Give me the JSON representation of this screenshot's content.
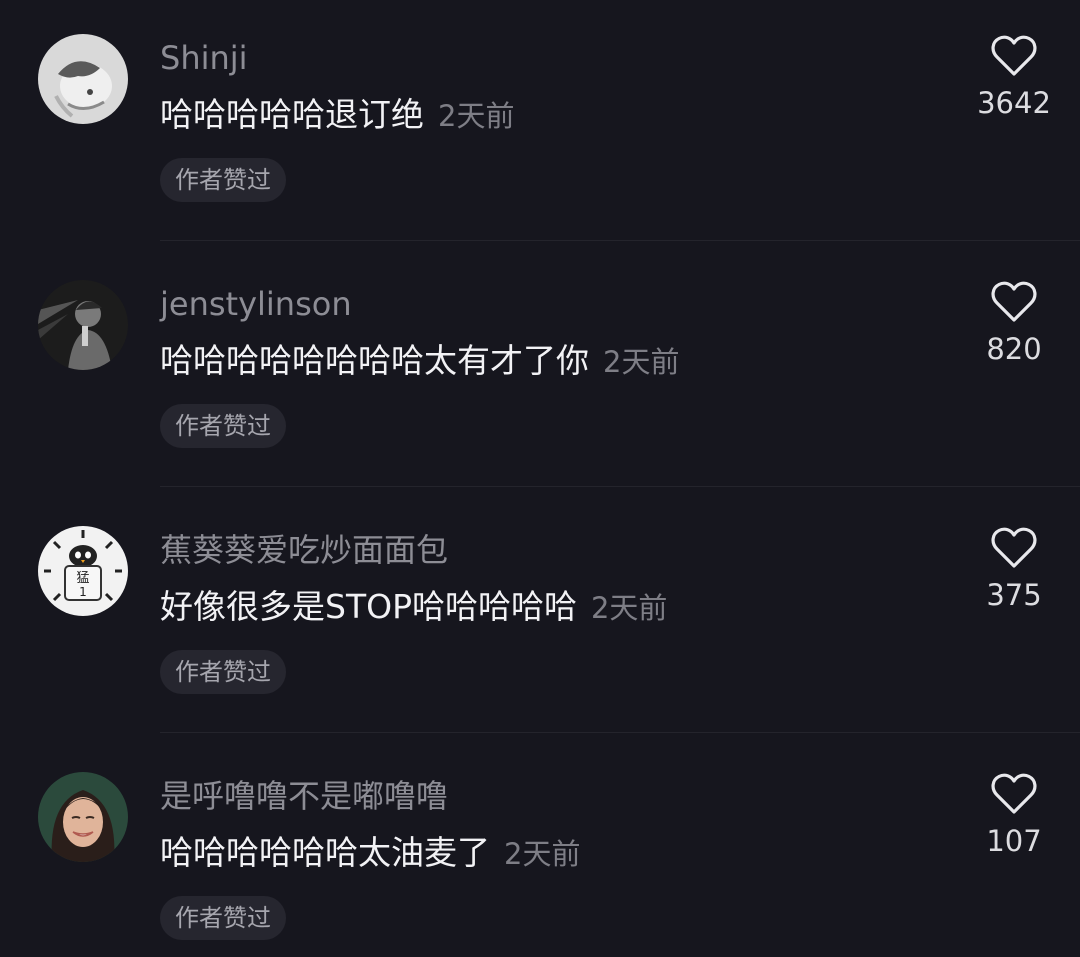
{
  "comments": [
    {
      "username": "Shinji",
      "text": "哈哈哈哈哈退订绝",
      "time": "2天前",
      "badge": "作者赞过",
      "likes": "3642"
    },
    {
      "username": "jenstylinson",
      "text": "哈哈哈哈哈哈哈哈太有才了你",
      "time": "2天前",
      "badge": "作者赞过",
      "likes": "820"
    },
    {
      "username": "蕉葵葵爱吃炒面面包",
      "text": "好像很多是STOP哈哈哈哈哈",
      "time": "2天前",
      "badge": "作者赞过",
      "likes": "375",
      "avatar_text": [
        "猛",
        "1"
      ]
    },
    {
      "username": "是呼噜噜不是嘟噜噜",
      "text": "哈哈哈哈哈哈太油麦了",
      "time": "2天前",
      "badge": "作者赞过",
      "likes": "107"
    }
  ]
}
